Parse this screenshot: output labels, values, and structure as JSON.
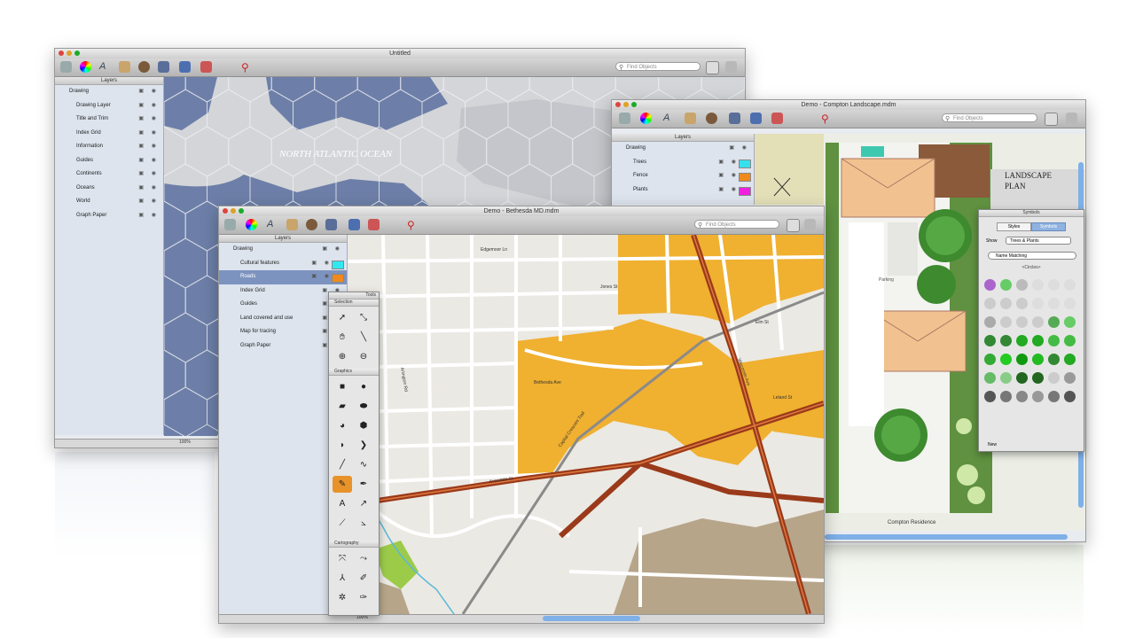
{
  "world_window": {
    "title": "Untitled",
    "search_placeholder": "Find Objects",
    "layers_header": "Layers",
    "layers": [
      {
        "name": "Drawing"
      },
      {
        "name": "Drawing Layer"
      },
      {
        "name": "Title and Trim"
      },
      {
        "name": "Index Grid"
      },
      {
        "name": "Information"
      },
      {
        "name": "Guides"
      },
      {
        "name": "Continents"
      },
      {
        "name": "Oceans"
      },
      {
        "name": "World"
      },
      {
        "name": "Graph Paper"
      }
    ],
    "map_label_ocean": "NORTH ATLANTIC OCEAN",
    "zoom": "100%"
  },
  "landscape_window": {
    "title": "Demo - Compton Landscape.mdm",
    "search_placeholder": "Find Objects",
    "layers_header": "Layers",
    "layers": [
      {
        "name": "Drawing"
      },
      {
        "name": "Trees",
        "color": "#35e0ee"
      },
      {
        "name": "Fence",
        "color": "#f08a1e"
      },
      {
        "name": "Plants",
        "color": "#f020e0"
      }
    ],
    "plan_title": "LANDSCAPE PLAN",
    "plan_title_l1": "LANDSCAPE",
    "plan_title_l2": "PLAN",
    "parking_label": "Parking",
    "caption": "Compton Residence"
  },
  "symbols_panel": {
    "title": "Symbols",
    "tab_styles": "Styles",
    "tab_symbols": "Symbols",
    "show_label": "Show",
    "show_value": "Trees & Plants",
    "search_value": "Name Matching",
    "category": "<Circles>",
    "footer_label": "New"
  },
  "bethesda_window": {
    "title": "Demo - Bethesda MD.mdm",
    "search_placeholder": "Find Objects",
    "layers_header": "Layers",
    "layers": [
      {
        "name": "Drawing"
      },
      {
        "name": "Cultural features",
        "color": "#30e8f0"
      },
      {
        "name": "Roads",
        "color": "#f08a1e",
        "selected": true
      },
      {
        "name": "Index Grid"
      },
      {
        "name": "Guides"
      },
      {
        "name": "Land covered and use"
      },
      {
        "name": "Map for tracing"
      },
      {
        "name": "Graph Paper"
      }
    ],
    "streets": [
      "Edgemoor Ln",
      "Bethesda Ave",
      "Wisconsin Ave",
      "Elm St",
      "Leland St",
      "Capital Crescent Trail",
      "Arlington Rd",
      "Jones St",
      "Avondale St",
      "Woodmont Ave"
    ],
    "zoom": "100%",
    "accent_colors": {
      "roads": "#9a3a1a",
      "zone": "#f0b030",
      "map_bg": "#ebe9e3"
    }
  },
  "tools_palette": {
    "title": "Tools",
    "sections": [
      "Selection",
      "Graphics",
      "Cartography"
    ]
  },
  "toolbar_icons": [
    "new-document-icon",
    "color-wheel-icon",
    "text-icon",
    "pen-icon",
    "palette-icon",
    "inspector-icon",
    "tools-icon",
    "layers-icon",
    "zoom-icon",
    "print-icon",
    "settings-icon"
  ]
}
